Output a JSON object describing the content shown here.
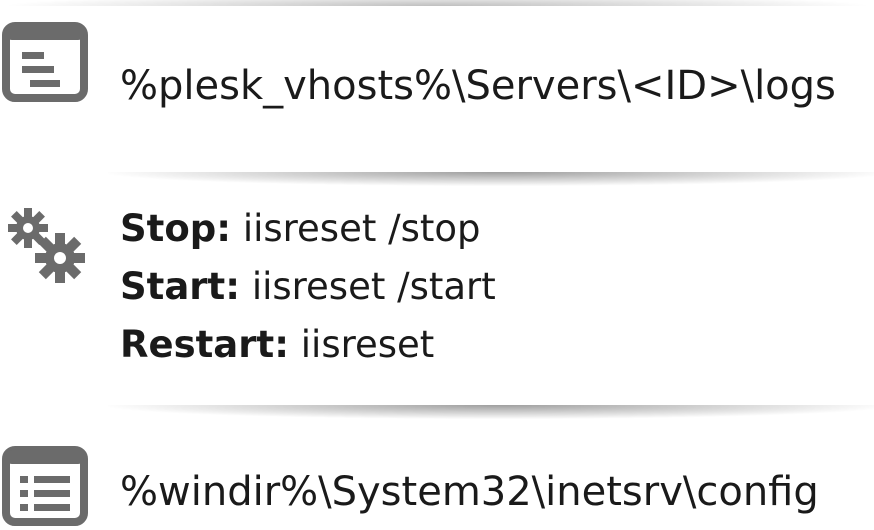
{
  "logs_section": {
    "icon": "log-window-icon",
    "path": "%plesk_vhosts%\\Servers\\<ID>\\logs"
  },
  "service_section": {
    "icon": "gears-icon",
    "commands": [
      {
        "label": "Stop:",
        "command": "iisreset /stop"
      },
      {
        "label": "Start:",
        "command": "iisreset /start"
      },
      {
        "label": "Restart:",
        "command": "iisreset"
      }
    ]
  },
  "config_section": {
    "icon": "config-list-icon",
    "path": "%windir%\\System32\\inetsrv\\config"
  },
  "colors": {
    "icon_gray": "#6b6b6b",
    "text": "#1a1a1a",
    "background": "#ffffff"
  }
}
